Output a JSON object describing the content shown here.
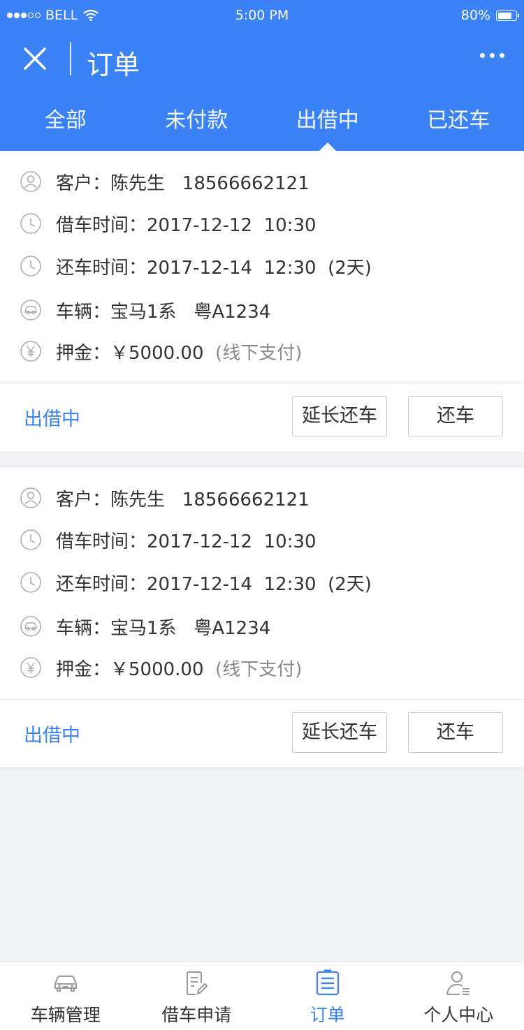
{
  "status_bar": {
    "carrier": "BELL",
    "time": "5:00 PM",
    "battery": "80%",
    "battery_level": 0.8
  },
  "nav": {
    "title": "订单",
    "close_icon": "close-icon",
    "more_icon": "more-icon"
  },
  "tabs": [
    {
      "label": "全部",
      "active": false
    },
    {
      "label": "未付款",
      "active": false
    },
    {
      "label": "出借中",
      "active": true
    },
    {
      "label": "已还车",
      "active": false
    }
  ],
  "orders": [
    {
      "customer": "客户：陈先生   18566662121",
      "borrow_time": "借车时间：2017-12-12  10:30",
      "return_time": "还车时间：2017-12-14  12:30  ",
      "duration": "(2天)",
      "vehicle": "车辆：宝马1系   粤A1234",
      "deposit": "押金：￥5000.00  ",
      "deposit_note": "(线下支付)",
      "status": "出借中",
      "extend_label": "延长还车",
      "return_label": "还车"
    },
    {
      "customer": "客户：陈先生   18566662121",
      "borrow_time": "借车时间：2017-12-12  10:30",
      "return_time": "还车时间：2017-12-14  12:30  ",
      "duration": "(2天)",
      "vehicle": "车辆：宝马1系   粤A1234",
      "deposit": "押金：￥5000.00  ",
      "deposit_note": "(线下支付)",
      "status": "出借中",
      "extend_label": "延长还车",
      "return_label": "还车"
    }
  ],
  "tabbar": [
    {
      "label": "车辆管理",
      "icon": "car-icon",
      "active": false
    },
    {
      "label": "借车申请",
      "icon": "edit-doc-icon",
      "active": false
    },
    {
      "label": "订单",
      "icon": "order-list-icon",
      "active": true
    },
    {
      "label": "个人中心",
      "icon": "user-profile-icon",
      "active": false
    }
  ],
  "colors": {
    "primary": "#3b82f6",
    "background": "#f1f2f5",
    "text": "#333333",
    "muted": "#8a8a8a"
  }
}
